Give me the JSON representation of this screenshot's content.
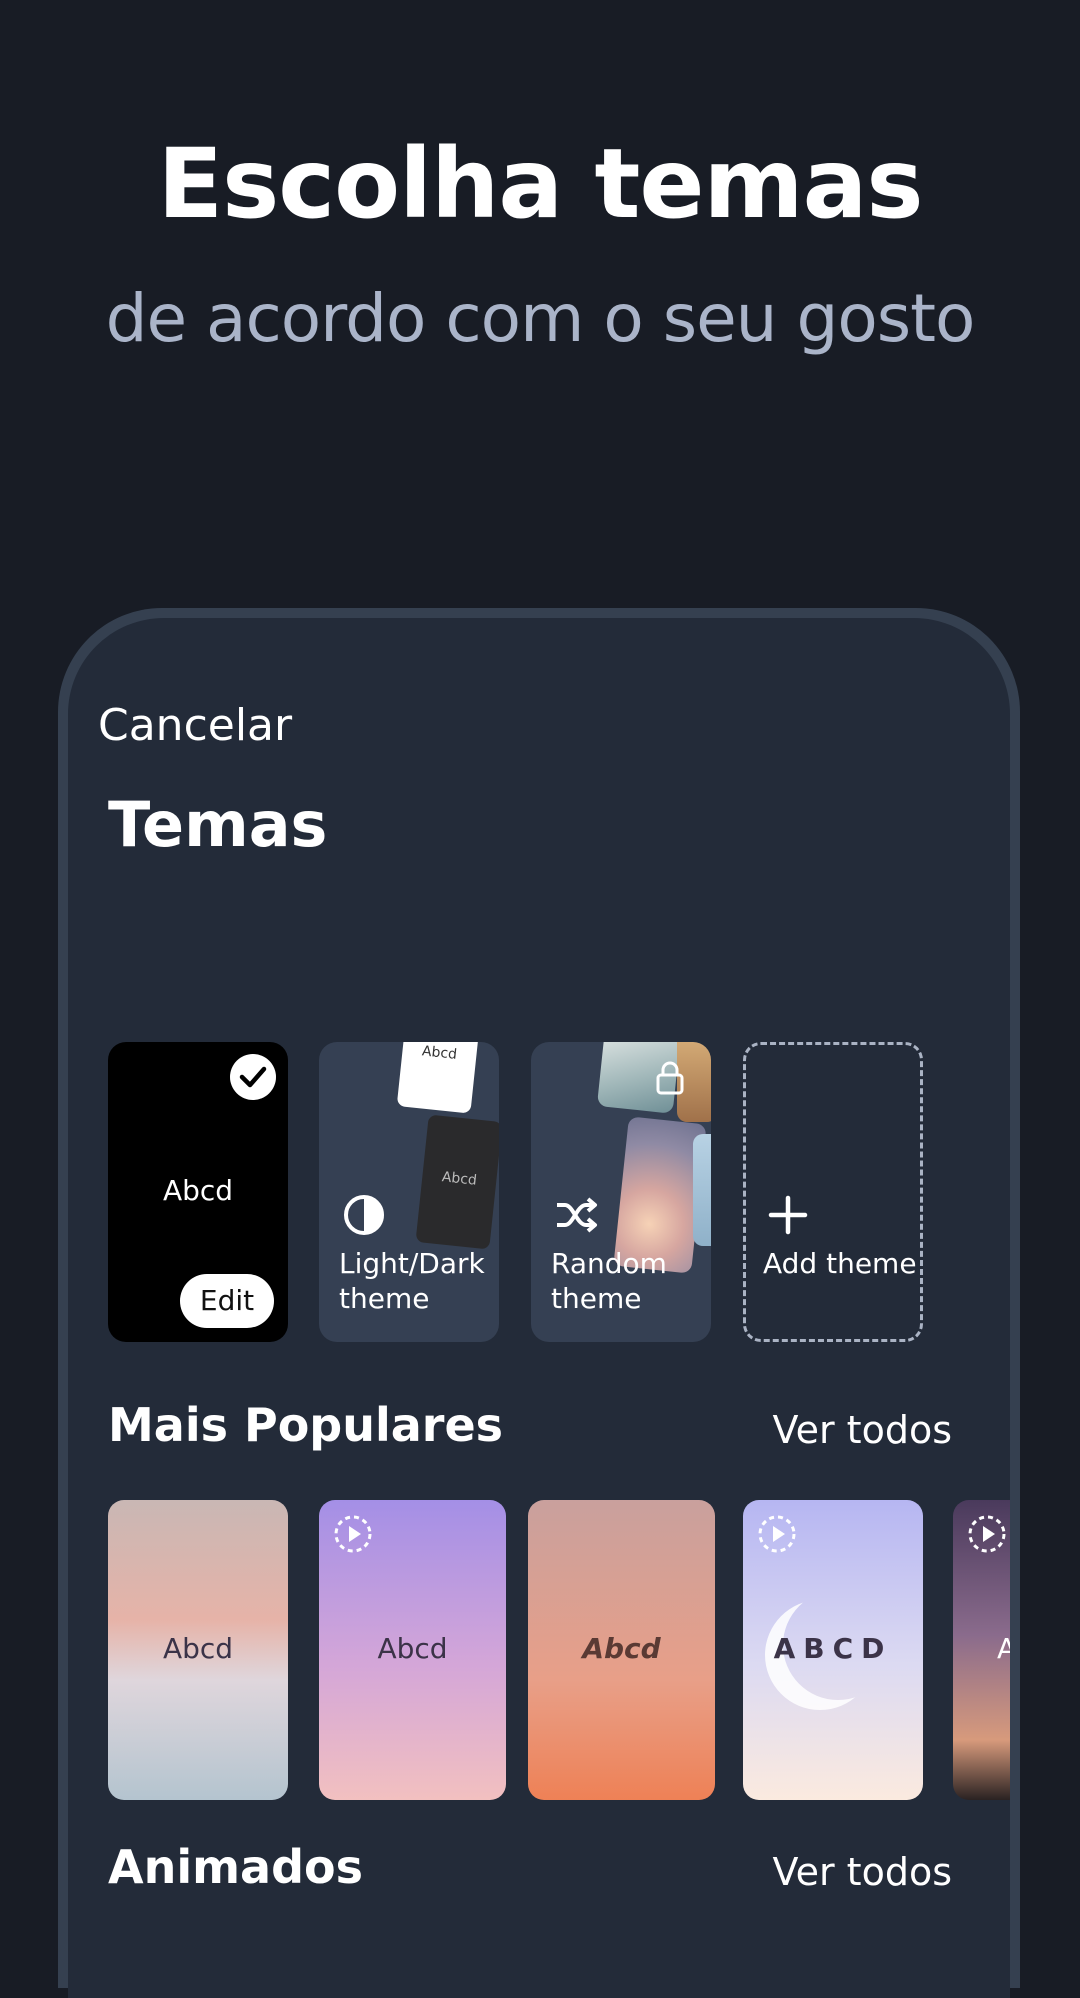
{
  "headline": "Escolha temas",
  "subheadline": "de acordo com o seu gosto",
  "screen": {
    "cancel_label": "Cancelar",
    "title": "Temas",
    "theme_cards": {
      "selected": {
        "preview_text": "Abcd",
        "edit_label": "Edit",
        "icon": "check-icon"
      },
      "light_dark": {
        "label": "Light/Dark theme",
        "mini_light": "Abcd",
        "mini_dark": "Abcd",
        "icon": "half-circle-icon"
      },
      "random": {
        "label": "Random theme",
        "icon": "shuffle-icon",
        "lock_icon": "lock-icon"
      },
      "add": {
        "label": "Add theme",
        "icon": "plus-icon"
      }
    },
    "popular": {
      "title": "Mais Populares",
      "see_all": "Ver todos",
      "items": [
        {
          "text": "Abcd",
          "animated": false
        },
        {
          "text": "Abcd",
          "animated": true
        },
        {
          "text": "Abcd",
          "animated": false
        },
        {
          "text": "ABCD",
          "animated": true
        },
        {
          "text": "A",
          "animated": true
        }
      ]
    },
    "animated": {
      "title": "Animados",
      "see_all": "Ver todos"
    }
  },
  "colors": {
    "background": "#181c25",
    "phone_frame": "#354050",
    "screen": "#232b39",
    "card": "#354053",
    "subheadline": "#aab4c9"
  }
}
